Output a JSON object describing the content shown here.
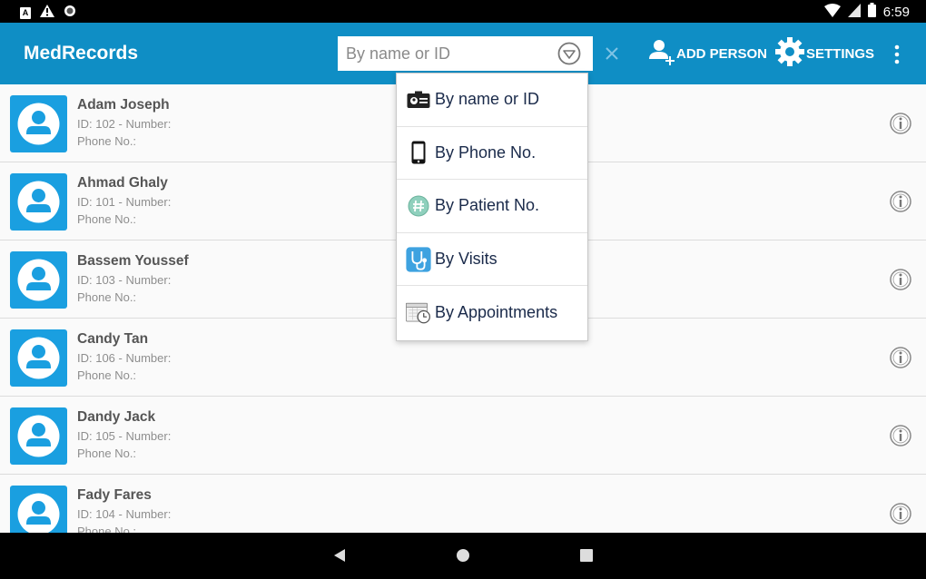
{
  "status_bar": {
    "time": "6:59",
    "notif_letter": "A"
  },
  "app": {
    "title": "MedRecords"
  },
  "search": {
    "placeholder": "By name or ID"
  },
  "toolbar": {
    "add_person_label": "ADD PERSON",
    "settings_label": "SETTINGS"
  },
  "dropdown": {
    "items": [
      {
        "label": "By name or ID",
        "icon": "id-card-icon"
      },
      {
        "label": "By Phone No.",
        "icon": "phone-icon"
      },
      {
        "label": "By Patient No.",
        "icon": "hash-badge-icon"
      },
      {
        "label": "By Visits",
        "icon": "stethoscope-icon"
      },
      {
        "label": "By Appointments",
        "icon": "calendar-clock-icon"
      }
    ]
  },
  "patients": [
    {
      "name": "Adam Joseph",
      "id_line": "ID: 102 - Number:",
      "phone_line": "Phone No.:"
    },
    {
      "name": "Ahmad Ghaly",
      "id_line": "ID: 101 - Number:",
      "phone_line": "Phone No.:"
    },
    {
      "name": "Bassem Youssef",
      "id_line": "ID: 103 - Number:",
      "phone_line": "Phone No.:"
    },
    {
      "name": "Candy Tan",
      "id_line": "ID: 106 - Number:",
      "phone_line": "Phone No.:"
    },
    {
      "name": "Dandy Jack",
      "id_line": "ID: 105 - Number:",
      "phone_line": "Phone No.:"
    },
    {
      "name": "Fady Fares",
      "id_line": "ID: 104 - Number:",
      "phone_line": "Phone No.:"
    }
  ],
  "colors": {
    "primary": "#0f8ec5",
    "avatar": "#1a9fe0"
  }
}
